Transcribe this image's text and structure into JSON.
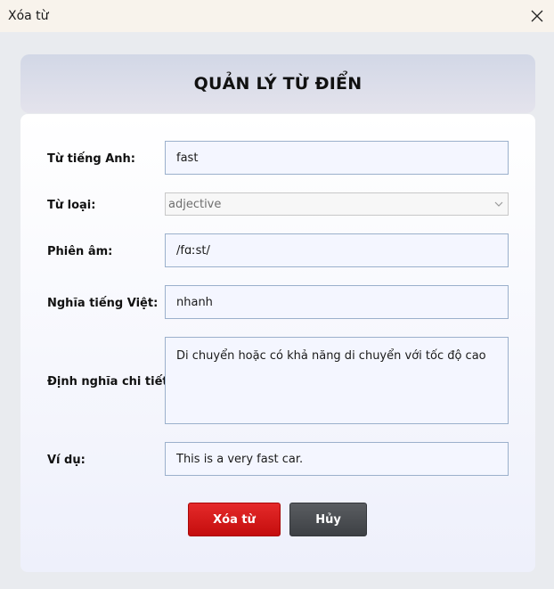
{
  "window": {
    "title": "Xóa từ"
  },
  "header": {
    "title": "QUẢN LÝ TỪ ĐIỂN"
  },
  "form": {
    "english_word": {
      "label": "Từ tiếng Anh:",
      "value": "fast"
    },
    "word_type": {
      "label": "Từ loại:",
      "value": "adjective"
    },
    "pronunciation": {
      "label": "Phiên âm:",
      "value": "/fɑːst/"
    },
    "vietnamese_meaning": {
      "label": "Nghĩa tiếng Việt:",
      "value": "nhanh"
    },
    "detailed_definition": {
      "label": "Định nghĩa chi tiết:",
      "value": "Di chuyển hoặc có khả năng di chuyển với tốc độ cao"
    },
    "example": {
      "label": "Ví dụ:",
      "value": "This is a very fast car."
    }
  },
  "buttons": {
    "delete_label": "Xóa từ",
    "cancel_label": "Hủy"
  },
  "icons": {
    "close": "close-icon",
    "dropdown": "chevron-down-icon"
  },
  "colors": {
    "delete": "#d41b1b",
    "cancel": "#4a4d51",
    "field_border": "#9bb0cc",
    "field_bg": "#f4f6ff"
  }
}
